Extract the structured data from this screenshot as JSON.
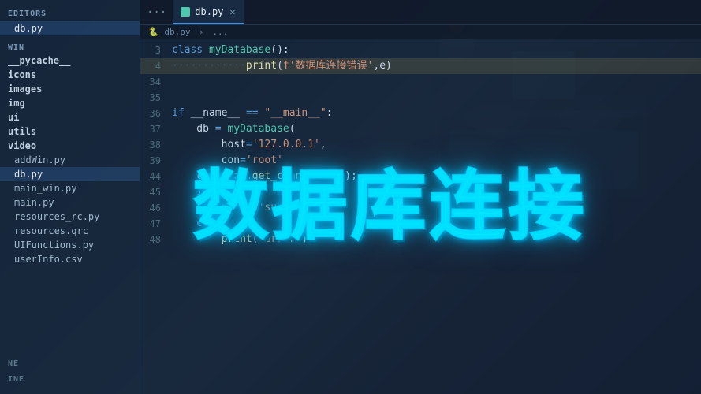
{
  "sidebar": {
    "editors_label": "EDITORS",
    "win_label": "WIN",
    "active_file": "db.py",
    "editors_files": [
      {
        "name": "db.py",
        "active": true
      }
    ],
    "win_folders": [
      {
        "name": "__pycache__",
        "type": "folder"
      },
      {
        "name": "icons",
        "type": "folder"
      },
      {
        "name": "images",
        "type": "folder"
      },
      {
        "name": "img",
        "type": "folder"
      },
      {
        "name": "ui",
        "type": "folder"
      },
      {
        "name": "utils",
        "type": "folder"
      },
      {
        "name": "video",
        "type": "folder"
      }
    ],
    "win_files": [
      {
        "name": "addWin.py"
      },
      {
        "name": "db.py"
      },
      {
        "name": "main_win.py"
      },
      {
        "name": "main.py"
      },
      {
        "name": "resources_rc.py"
      },
      {
        "name": "resources.qrc"
      },
      {
        "name": "UIFunctions.py"
      },
      {
        "name": "userInfo.csv"
      }
    ],
    "bottom_labels": [
      "NE",
      "INE"
    ]
  },
  "tabs": [
    {
      "label": "db.py",
      "active": true,
      "dots": "..."
    }
  ],
  "breadcrumb": {
    "path": "db.py",
    "separator": "›",
    "extra": "..."
  },
  "code": {
    "lines": [
      {
        "num": "3",
        "content": "class myDatabase():"
      },
      {
        "num": "4",
        "content": "·············print(f'数据库连接错误',e)"
      },
      {
        "num": "34",
        "content": ""
      },
      {
        "num": "35",
        "content": ""
      },
      {
        "num": "36",
        "content": "if __name__ == \"__main__\":"
      },
      {
        "num": "37",
        "content": "    db = myDatabase("
      },
      {
        "num": "38",
        "content": "        host='127.0.0.1',"
      },
      {
        "num": "39",
        "content": "        con='root'"
      },
      {
        "num": "44",
        "content": "    con = db.get_connection();"
      },
      {
        "num": "45",
        "content": "    if con:"
      },
      {
        "num": "46",
        "content": "        print('succ')"
      },
      {
        "num": "47",
        "content": "    else:"
      },
      {
        "num": "48",
        "content": "        print('error')"
      }
    ]
  },
  "overlay": {
    "title": "数据库连接"
  },
  "colors": {
    "accent": "#00e5ff",
    "background": "#1a2a3a",
    "sidebar_bg": "#14233a",
    "editor_bg": "#121e30"
  }
}
